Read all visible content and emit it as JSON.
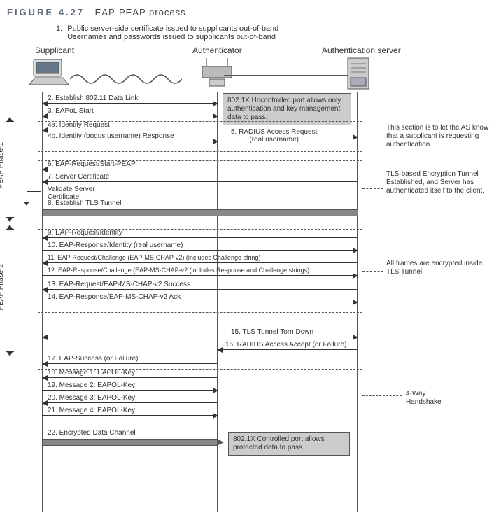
{
  "figure": {
    "number": "FIGURE 4.27",
    "title": "EAP-PEAP process"
  },
  "step1": {
    "num": "1.",
    "line1": "Public server-side certificate issued to supplicants out-of-band",
    "line2": "Usernames and passwords issued to supplicants out-of-band"
  },
  "roles": {
    "supplicant": "Supplicant",
    "authenticator": "Authenticator",
    "server": "Authentication server"
  },
  "arrows": {
    "a2": "2. Establish 802.11 Data Link",
    "a3": "3. EAPoL Start",
    "a4a": "4a. Identity Request",
    "a4b": "4b. Identity (bogus username) Response",
    "a5": "5. RADIUS Access Request\n(real username)",
    "a6": "6. EAP-Request/Start-PEAP",
    "a7": "7. Server Certificate",
    "a8": "8. Establish TLS Tunnel",
    "a9": "9. EAP-Request/Identity",
    "a10": "10. EAP-Response/Identity (real username)",
    "a11": "11. EAP-Request/Challenge (EAP-MS-CHAP-v2) (includes Challenge string)",
    "a12": "12. EAP-Response/Challenge (EAP-MS-CHAP-v2 (includes Response and Challenge strings)",
    "a13": "13. EAP-Request/EAP-MS-CHAP-v2 Success",
    "a14": "14. EAP-Response/EAP-MS-CHAP-v2 Ack",
    "a15": "15. TLS Tunnel Torn Down",
    "a16": "16. RADIUS Access Accept (or Failure)",
    "a17": "17. EAP-Success (or Failure)",
    "a18": "18. Message 1: EAPOL-Key",
    "a19": "19. Message 2: EAPOL-Key",
    "a20": "20. Message 3: EAPOL-Key",
    "a21": "21. Message 4: EAPOL-Key",
    "a22": "22. Encrypted Data Channel"
  },
  "callouts": {
    "uncontrolled": "802.1X Uncontrolled port allows only authentication and key management data to pass.",
    "controlled": "802.1X Controlled port allows protected data to pass."
  },
  "notes": {
    "validate": "Validate Server\nCertificate",
    "right1": "This section is to let the AS know that a supplicant is requesting authentication",
    "right2": "TLS-based Encryption Tunnel Established, and Server has authenticated itself to the client.",
    "right3": "All frames are encrypted inside TLS Tunnel",
    "right4": "4-Way\nHandshake"
  },
  "phases": {
    "p1": "PEAP Phase-1",
    "p2": "PEAP Phase-2"
  }
}
